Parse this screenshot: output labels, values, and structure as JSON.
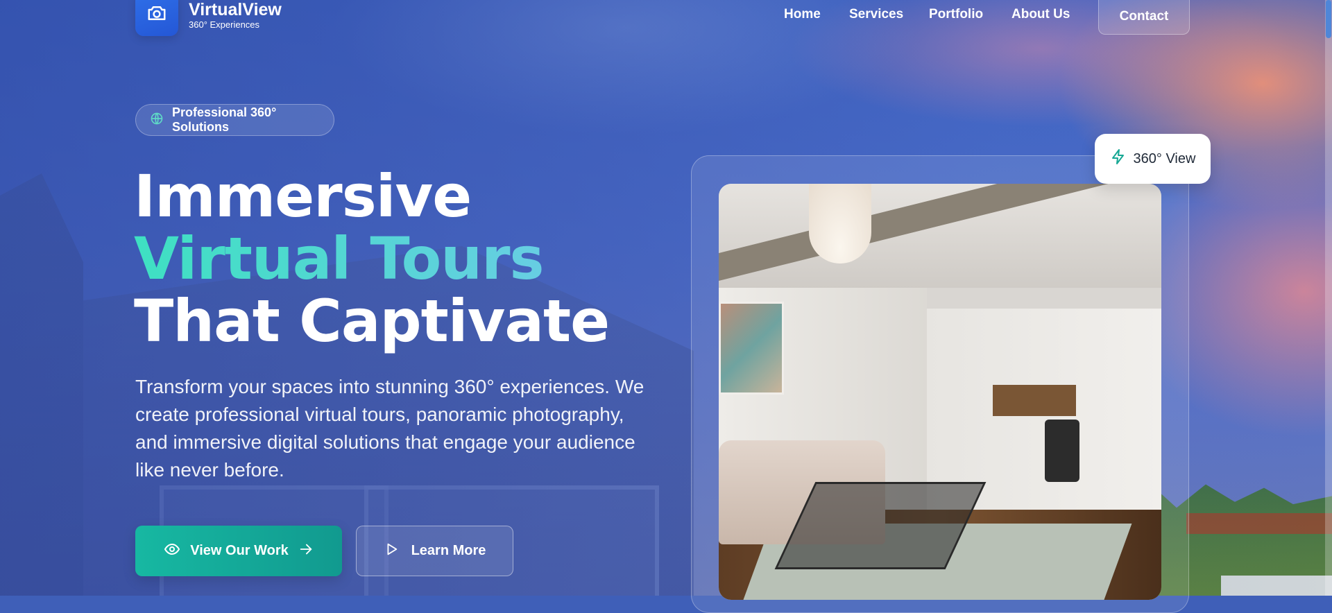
{
  "header": {
    "brand_name": "VirtualView",
    "brand_sub": "360° Experiences",
    "nav": [
      "Home",
      "Services",
      "Portfolio",
      "About Us"
    ],
    "contact": "Contact"
  },
  "hero": {
    "badge": "Professional 360° Solutions",
    "headline_line1": "Immersive",
    "headline_line2": "Virtual Tours",
    "headline_line3": "That Captivate",
    "description": "Transform your spaces into stunning 360° experiences. We create professional virtual tours, panoramic photography, and immersive digital solutions that engage your audience like never before.",
    "primary_button": "View Our Work",
    "secondary_button": "Learn More"
  },
  "showcase": {
    "badge": "360° View"
  },
  "icons": {
    "logo": "camera-icon",
    "badge": "globe-icon",
    "primary": "eye-icon",
    "primary_arrow": "arrow-right-icon",
    "secondary": "play-icon",
    "showcase": "lightning-icon"
  },
  "colors": {
    "accent_teal": "#17b8a2",
    "logo_blue": "#2457d6",
    "headline_gradient_start": "#3ee0c2",
    "headline_gradient_end": "#6ecbe8"
  }
}
